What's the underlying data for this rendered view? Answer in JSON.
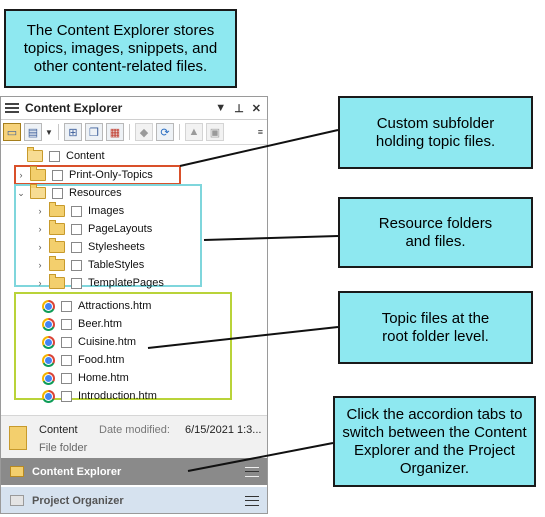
{
  "callouts": {
    "intro": "The Content Explorer stores topics, images, snippets, and other content-related files.",
    "subfolder": "Custom subfolder holding topic files.",
    "resources": "Resource folders and files.",
    "topics": "Topic files at the root folder level.",
    "accordion": "Click the accordion tabs to switch between the Content Explorer and the Project Organizer."
  },
  "panel": {
    "title": "Content Explorer",
    "title_controls": [
      "▼",
      "⊥",
      "✕"
    ]
  },
  "tree": {
    "root": "Content",
    "subfolder": "Print-Only-Topics",
    "resources": "Resources",
    "resource_folders": [
      "Images",
      "PageLayouts",
      "Stylesheets",
      "TableStyles",
      "TemplatePages"
    ],
    "topic_files": [
      "Attractions.htm",
      "Beer.htm",
      "Cuisine.htm",
      "Food.htm",
      "Home.htm",
      "Introduction.htm"
    ]
  },
  "info": {
    "name": "Content",
    "type": "File folder",
    "date_label": "Date modified:",
    "date_value": "6/15/2021 1:3..."
  },
  "accordion": {
    "tab1": "Content Explorer",
    "tab2": "Project Organizer"
  },
  "colors": {
    "callout_fill": "#8ee8f0",
    "subfolder_box": "#d9502a",
    "resources_box": "#7fd6dc",
    "topics_box": "#b9d339"
  }
}
